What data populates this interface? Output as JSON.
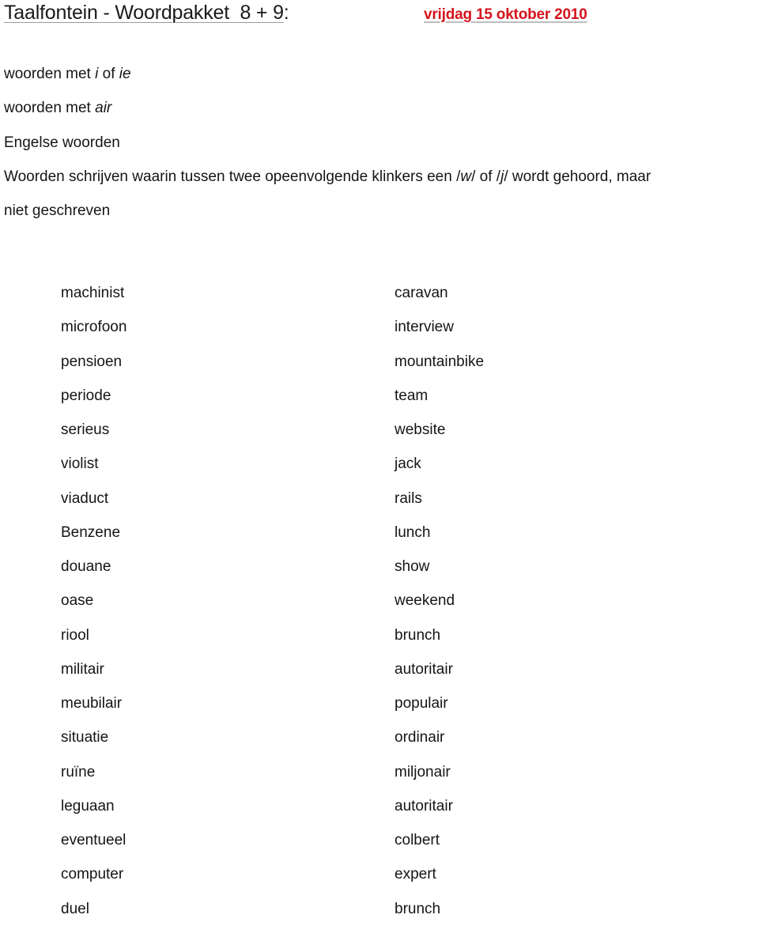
{
  "header": {
    "title": "Taalfontein - Woordpakket  8 + 9",
    "title_colon": ":",
    "date": "vrijdag 15 oktober 2010",
    "date_color": "#d4141c"
  },
  "topics": [
    {
      "parts": [
        {
          "text": "woorden met ",
          "italic": false
        },
        {
          "text": "i",
          "italic": true
        },
        {
          "text": " of ",
          "italic": false
        },
        {
          "text": "ie",
          "italic": true
        }
      ]
    },
    {
      "parts": [
        {
          "text": "woorden met ",
          "italic": false
        },
        {
          "text": "air",
          "italic": true
        }
      ]
    },
    {
      "parts": [
        {
          "text": "Engelse woorden",
          "italic": false
        }
      ]
    },
    {
      "parts": [
        {
          "text": "Woorden schrijven waarin tussen twee opeenvolgende klinkers een /",
          "italic": false
        },
        {
          "text": "w",
          "italic": true
        },
        {
          "text": "/ of /",
          "italic": false
        },
        {
          "text": "j",
          "italic": true
        },
        {
          "text": "/ wordt gehoord, maar",
          "italic": false
        }
      ]
    },
    {
      "parts": [
        {
          "text": "niet geschreven",
          "italic": false
        }
      ]
    }
  ],
  "word_lists": {
    "left": [
      "machinist",
      "microfoon",
      "pensioen",
      "periode",
      "serieus",
      "violist",
      "viaduct",
      "Benzene",
      "douane",
      "oase",
      "riool",
      "militair",
      "meubilair",
      "situatie",
      "ruïne",
      "leguaan",
      "eventueel",
      "computer",
      "duel"
    ],
    "right": [
      "caravan",
      "interview",
      "mountainbike",
      "team",
      "website",
      "jack",
      "rails",
      "lunch",
      "show",
      "weekend",
      "brunch",
      "autoritair",
      "populair",
      "ordinair",
      "miljonair",
      "autoritair",
      "colbert",
      "expert",
      "brunch"
    ]
  }
}
